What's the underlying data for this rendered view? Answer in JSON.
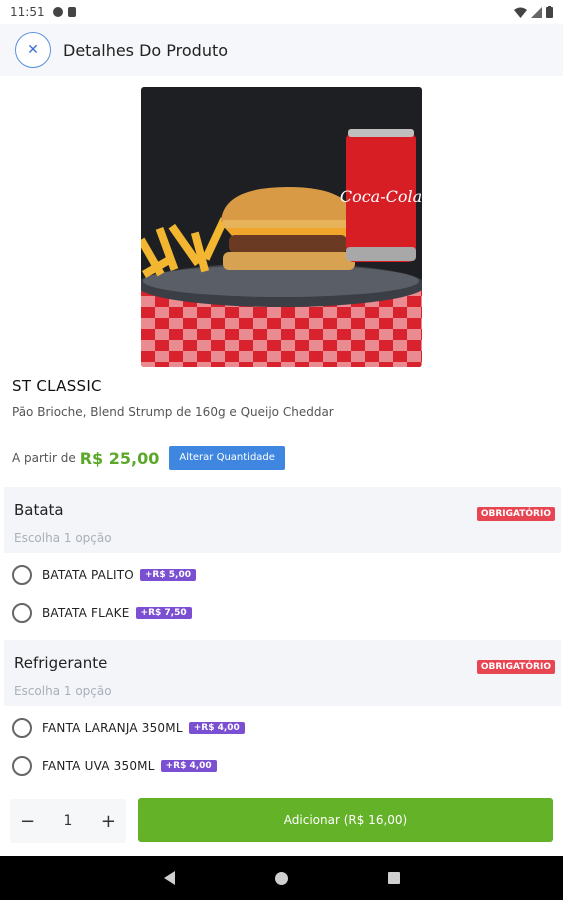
{
  "status_bar": {
    "time": "11:51"
  },
  "header": {
    "title": "Detalhes Do Produto",
    "close_icon": "✕"
  },
  "product": {
    "name": "ST CLASSIC",
    "description": "Pão Brioche, Blend Strump de 160g e Queijo Cheddar",
    "price_prefix": "A partir de",
    "price": "R$ 25,00",
    "change_quantity_label": "Alterar Quantidade",
    "image_brand_text": "Coca-Cola"
  },
  "groups": [
    {
      "title": "Batata",
      "subtitle": "Escolha 1 opção",
      "badge": "OBRIGATÓRIO",
      "options": [
        {
          "label": "BATATA PALITO",
          "price": "+R$ 5,00"
        },
        {
          "label": "BATATA FLAKE",
          "price": "+R$ 7,50"
        }
      ]
    },
    {
      "title": "Refrigerante",
      "subtitle": "Escolha 1 opção",
      "badge": "OBRIGATÓRIO",
      "options": [
        {
          "label": "FANTA LARANJA 350ML",
          "price": "+R$ 4,00"
        },
        {
          "label": "FANTA UVA 350ML",
          "price": "+R$ 4,00"
        }
      ]
    }
  ],
  "footer": {
    "minus": "−",
    "quantity": "1",
    "plus": "+",
    "add_label": "Adicionar (R$ 16,00)"
  },
  "colors": {
    "accent_green": "#64b228",
    "price_green": "#5ba82a",
    "button_blue": "#3f86e0",
    "required_red": "#e84552",
    "option_purple": "#7a4fd1"
  }
}
